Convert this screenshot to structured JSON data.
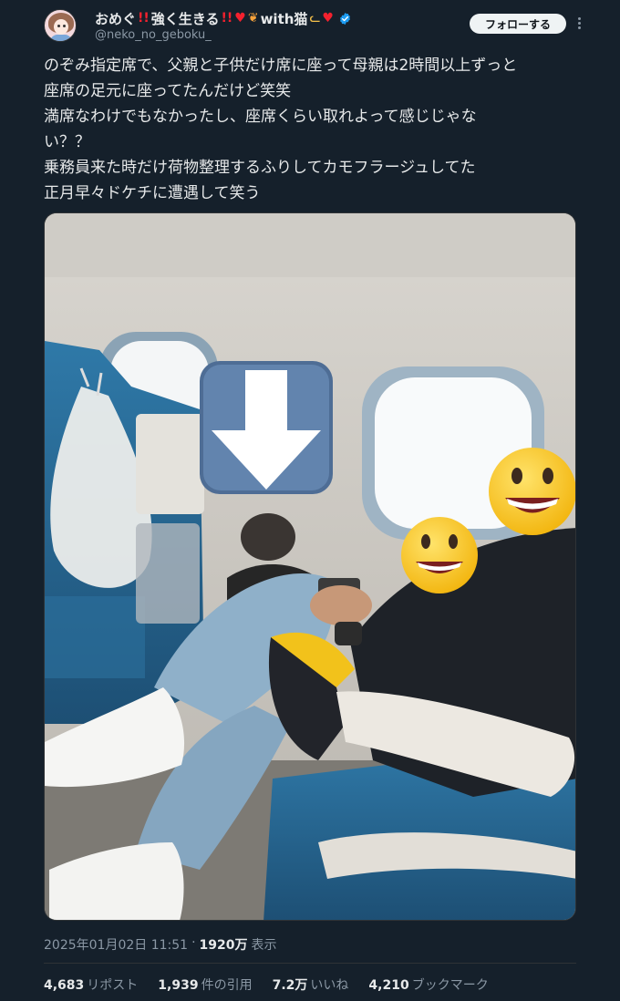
{
  "tweet": {
    "author": {
      "display_name": "おめぐ",
      "name_suffix_1": "強く生きる",
      "name_suffix_2": "with猫",
      "handle": "@neko_no_geboku_",
      "verified": true,
      "avatar_icon": "anime-girl-avatar"
    },
    "follow_label": "フォローする",
    "text_lines": [
      "のぞみ指定席で、父親と子供だけ席に座って母親は2時間以上ずっと",
      "座席の足元に座ってたんだけど笑笑",
      "満席なわけでもなかったし、座席くらい取れよって感じじゃな",
      "い？？",
      "乗務員来た時だけ荷物整理するふりしてカモフラージュしてた",
      "正月早々ドケチに遭遇して笑う"
    ],
    "timestamp": "2025年01月02日 11:51",
    "views_count": "1920万",
    "views_label": "表示",
    "stats": {
      "retweets": {
        "count": "4,683",
        "label": "リポスト"
      },
      "quotes": {
        "count": "1,939",
        "label": "件の引用"
      },
      "likes": {
        "count": "7.2万",
        "label": "いいね"
      },
      "bookmarks": {
        "count": "4,210",
        "label": "ブックマーク"
      }
    },
    "media": {
      "description_icons": [
        "down-arrow-emoji-icon",
        "grinning-face-emoji-icon",
        "grinning-face-emoji-icon"
      ]
    }
  },
  "colors": {
    "background": "#15202b",
    "text_primary": "#e7e9ea",
    "text_secondary": "#8b98a5",
    "verified_blue": "#1d9bf0",
    "accent_red": "#f4212e"
  }
}
